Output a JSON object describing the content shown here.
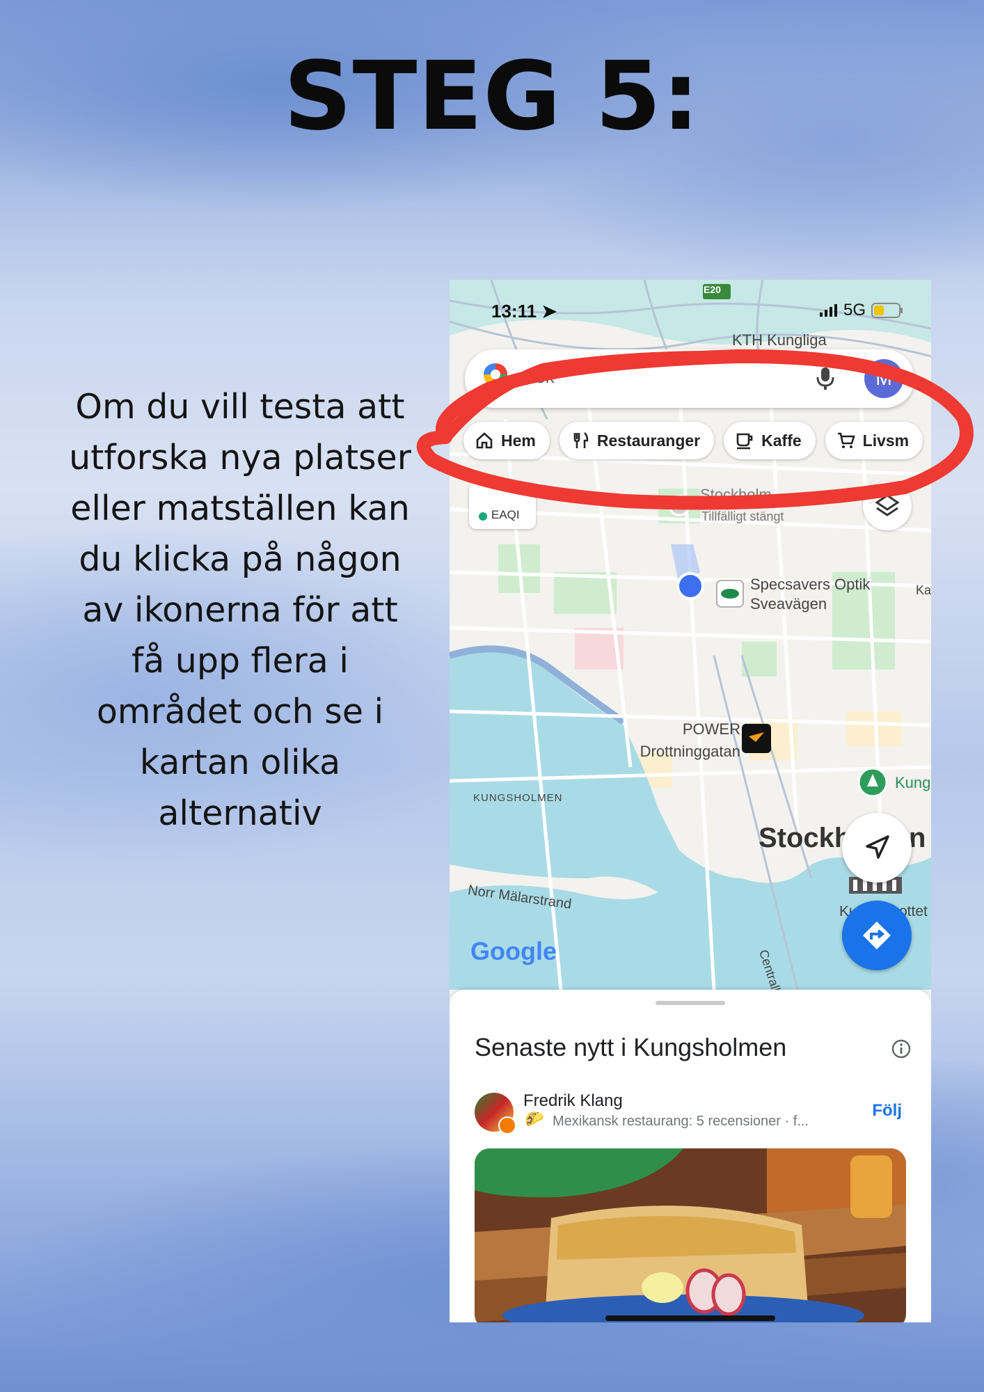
{
  "headline": "STEG 5:",
  "instructions": "Om du vill testa att utforska nya platser eller matställen kan du klicka på någon av ikonerna för att få upp flera i området och se i kartan olika alternativ",
  "phone": {
    "status": {
      "time": "13:11",
      "network": "5G"
    },
    "search": {
      "placeholder": "Sök",
      "avatar_letter": "M"
    },
    "chips": [
      {
        "label": "Hem",
        "icon": "home-icon"
      },
      {
        "label": "Restauranger",
        "icon": "restaurant-icon"
      },
      {
        "label": "Kaffe",
        "icon": "coffee-icon"
      },
      {
        "label": "Livsm",
        "icon": "cart-icon"
      }
    ],
    "eaqi_label": "EAQI",
    "map_labels": {
      "e20": "E20",
      "kth": "KTH Kungliga",
      "stockholm_top": "Stockholm",
      "closed": "Tillfälligt stängt",
      "specsavers_line1": "Specsavers Optik",
      "specsavers_line2": "Sveavägen",
      "power_line1": "POWER",
      "power_line2": "Drottninggatan",
      "kungsholmen": "KUNGSHOLMEN",
      "kung": "Kung",
      "stockholm_big": "Stockh",
      "stockholm_big_tail": "n",
      "norr_malarstrand": "Norr Mälarstrand",
      "centralbron": "Centralbron",
      "kungstradgarden": "Kung",
      "kungstradgarden_tail": "ottet",
      "ka": "Ka"
    },
    "google_logo": "Google",
    "sheet": {
      "title": "Senaste nytt i Kungsholmen",
      "post": {
        "author": "Fredrik Klang",
        "subtitle": "Mexikansk restaurang: 5 recensioner · f...",
        "follow_label": "Följ"
      }
    }
  },
  "colors": {
    "accent_blue": "#1a73e8",
    "annotation_red": "#ee3a32"
  }
}
